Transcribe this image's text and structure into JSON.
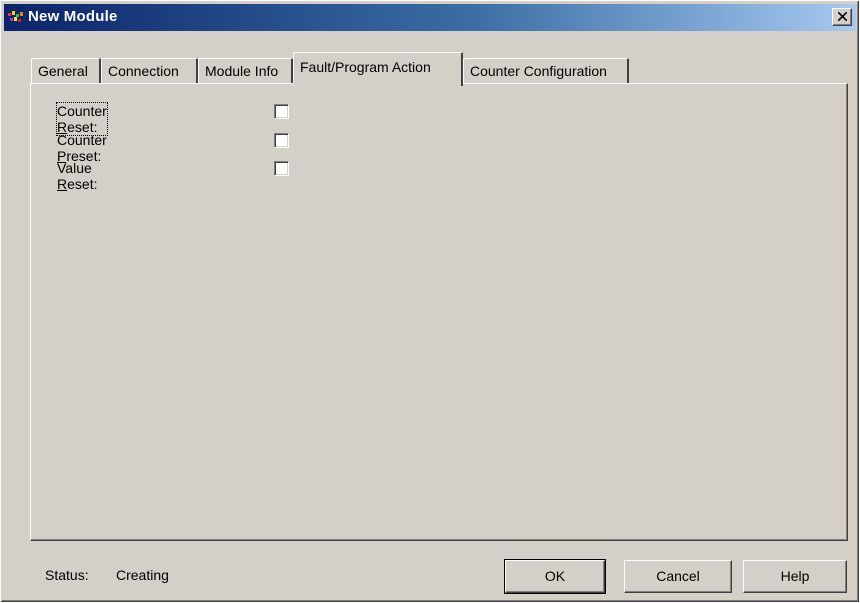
{
  "window": {
    "title": "New Module",
    "close_icon": "close-icon"
  },
  "tabs": [
    {
      "label": "General",
      "active": false
    },
    {
      "label": "Connection",
      "active": false
    },
    {
      "label": "Module Info",
      "active": false
    },
    {
      "label": "Fault/Program Action",
      "active": true
    },
    {
      "label": "Counter Configuration",
      "active": false
    }
  ],
  "options": [
    {
      "pre": "Counter ",
      "key": "R",
      "post": "eset:",
      "checked": false
    },
    {
      "pre": "Counter ",
      "key": "P",
      "post": "reset:",
      "checked": false
    },
    {
      "pre": "Value ",
      "key": "R",
      "post": "eset:",
      "checked": false
    }
  ],
  "status": {
    "label": "Status:",
    "value": "Creating"
  },
  "buttons": {
    "ok": "OK",
    "cancel": "Cancel",
    "help": "Help"
  },
  "colors": {
    "title_start": "#0a246a",
    "title_end": "#a6caf0",
    "face": "#d4d0c8"
  }
}
